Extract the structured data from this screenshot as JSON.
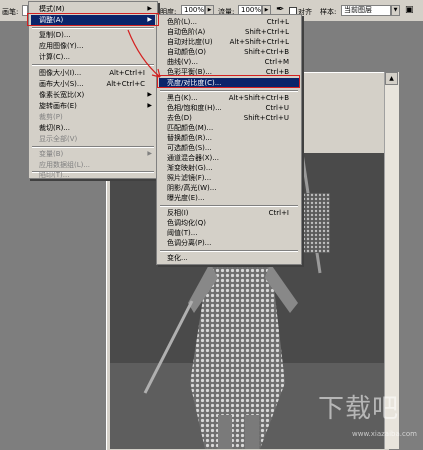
{
  "optbar": {
    "label_left": "画笔:",
    "brightness_label": "明度:",
    "brightness_value": "100%",
    "flow_label": "流量:",
    "flow_value": "100%",
    "align_label": "对齐",
    "sample_label": "样本:",
    "sample_value": "当前图层"
  },
  "image_menu": {
    "items": [
      {
        "label": "模式(M)",
        "submenu": true
      },
      {
        "label": "调整(A)",
        "submenu": true,
        "highlighted": true
      },
      {
        "label": "复制(D)..."
      },
      {
        "label": "应用图像(Y)..."
      },
      {
        "label": "计算(C)..."
      },
      {
        "label": "图像大小(I)...",
        "shortcut": "Alt+Ctrl+I"
      },
      {
        "label": "画布大小(S)...",
        "shortcut": "Alt+Ctrl+C"
      },
      {
        "label": "像素长宽比(X)",
        "submenu": true
      },
      {
        "label": "旋转画布(E)",
        "submenu": true
      },
      {
        "label": "裁剪(P)",
        "disabled": true
      },
      {
        "label": "裁切(R)..."
      },
      {
        "label": "显示全部(V)",
        "disabled": true
      },
      {
        "label": "变量(B)",
        "submenu": true,
        "disabled": true
      },
      {
        "label": "应用数据组(L)...",
        "disabled": true
      },
      {
        "label": "陷印(T)...",
        "disabled": true
      }
    ]
  },
  "adjust_menu": {
    "items": [
      {
        "label": "色阶(L)...",
        "shortcut": "Ctrl+L"
      },
      {
        "label": "自动色阶(A)",
        "shortcut": "Shift+Ctrl+L"
      },
      {
        "label": "自动对比度(U)",
        "shortcut": "Alt+Shift+Ctrl+L"
      },
      {
        "label": "自动颜色(O)",
        "shortcut": "Shift+Ctrl+B"
      },
      {
        "label": "曲线(V)...",
        "shortcut": "Ctrl+M"
      },
      {
        "label": "色彩平衡(B)...",
        "shortcut": "Ctrl+B"
      },
      {
        "label": "亮度/对比度(C)...",
        "highlighted": true
      },
      {
        "label": "黑白(K)...",
        "shortcut": "Alt+Shift+Ctrl+B"
      },
      {
        "label": "色相/饱和度(H)...",
        "shortcut": "Ctrl+U"
      },
      {
        "label": "去色(D)",
        "shortcut": "Shift+Ctrl+U"
      },
      {
        "label": "匹配颜色(M)..."
      },
      {
        "label": "替换颜色(R)..."
      },
      {
        "label": "可选颜色(S)..."
      },
      {
        "label": "通道混合器(X)..."
      },
      {
        "label": "渐变映射(G)..."
      },
      {
        "label": "照片滤镜(F)..."
      },
      {
        "label": "阴影/高光(W)..."
      },
      {
        "label": "曝光度(E)..."
      },
      {
        "label": "反相(I)",
        "shortcut": "Ctrl+I"
      },
      {
        "label": "色调均化(Q)"
      },
      {
        "label": "阈值(T)..."
      },
      {
        "label": "色调分离(P)..."
      },
      {
        "label": "变化..."
      }
    ]
  },
  "watermark": {
    "main": "下载吧",
    "sub": "www.xiazaiba.com"
  },
  "colors": {
    "menu_bg": "#d4d0c8",
    "highlight": "#0a246a",
    "annotation_red": "#d42020"
  }
}
